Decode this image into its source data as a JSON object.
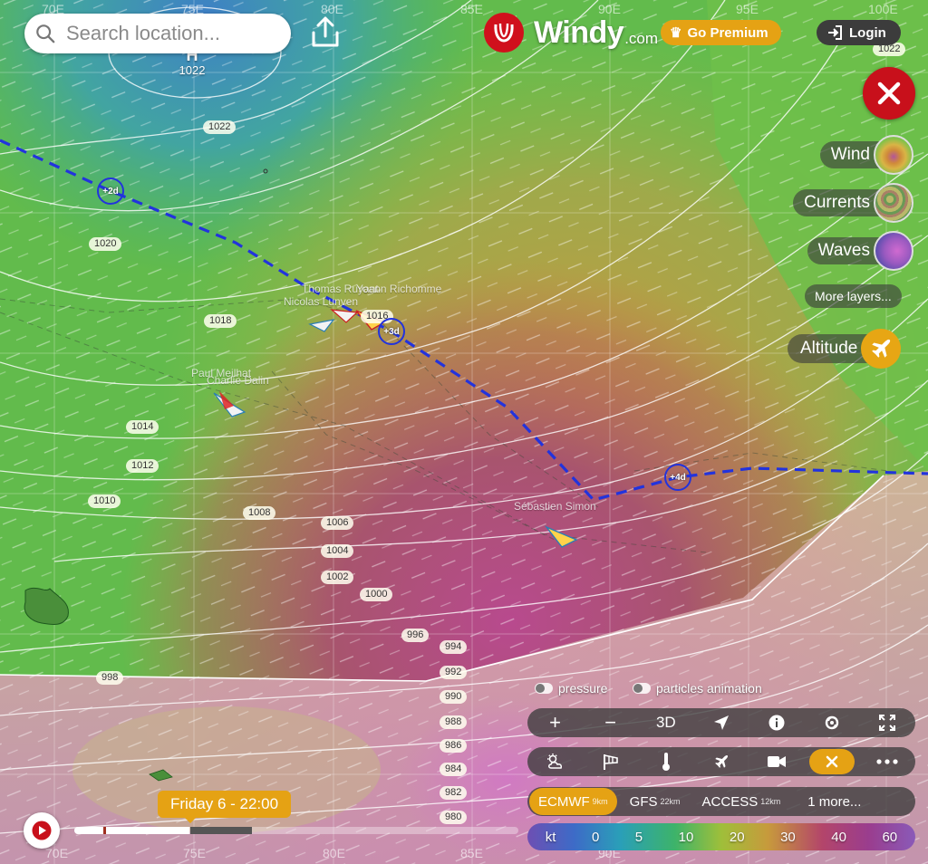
{
  "search": {
    "placeholder": "Search location..."
  },
  "brand": {
    "name": "Windy",
    "domain": ".com"
  },
  "header": {
    "premium_label": "Go Premium",
    "login_label": "Login"
  },
  "layers": [
    {
      "label": "Wind"
    },
    {
      "label": "Currents"
    },
    {
      "label": "Waves"
    }
  ],
  "more_layers_label": "More layers...",
  "altitude_label": "Altitude",
  "map": {
    "longitude_labels": [
      "70E",
      "75E",
      "80E",
      "85E",
      "90E",
      "95E",
      "100E"
    ],
    "high_marker": "H",
    "high_value": "1022",
    "isobars": [
      "1022",
      "1022",
      "1020",
      "1018",
      "1016",
      "1014",
      "1012",
      "1010",
      "1008",
      "1006",
      "1004",
      "1002",
      "1000",
      "998",
      "996",
      "994",
      "992",
      "990",
      "988",
      "986",
      "984",
      "982",
      "980"
    ],
    "route_markers": [
      "+2d",
      "+3d",
      "+4d"
    ],
    "boat_labels": [
      "Thomas Ruyant",
      "Charlie Dalin",
      "Nicolas Lunven",
      "Paul Meilhat",
      "Yoann Richomme",
      "Sébastien Simon"
    ]
  },
  "toggles": {
    "pressure": "pressure",
    "particles": "particles animation"
  },
  "toolbar": {
    "zoom_in": "+",
    "zoom_out": "−",
    "view_3d": "3D"
  },
  "models": [
    {
      "name": "ECMWF",
      "res": "9km",
      "selected": true
    },
    {
      "name": "GFS",
      "res": "22km",
      "selected": false
    },
    {
      "name": "ACCESS",
      "res": "12km",
      "selected": false
    },
    {
      "name": "1 more...",
      "res": "",
      "selected": false
    }
  ],
  "legend": {
    "unit": "kt",
    "values": [
      "0",
      "5",
      "10",
      "20",
      "30",
      "40",
      "60"
    ]
  },
  "timeline": {
    "current_time": "Friday 6 - 22:00",
    "progress": 0.26
  },
  "colors": {
    "accent": "#e5a214",
    "brand_red": "#d0101c",
    "route": "#2233dd"
  }
}
